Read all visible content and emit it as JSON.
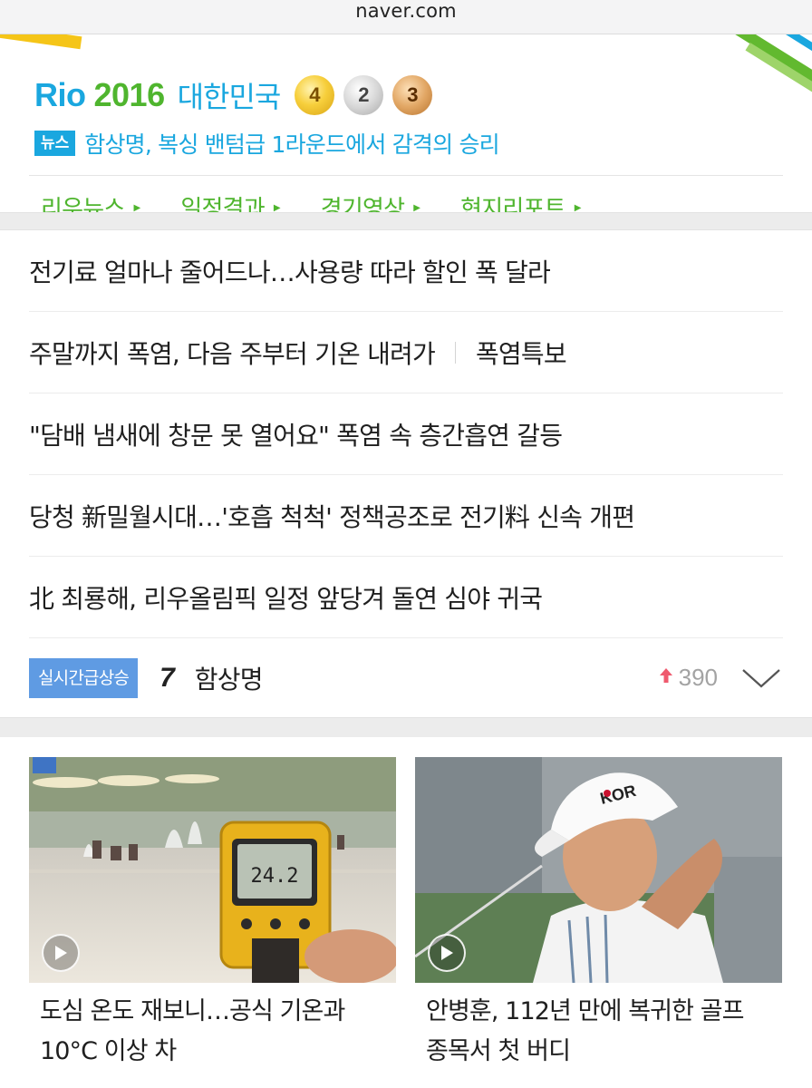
{
  "browser": {
    "url": "naver.com"
  },
  "olympics": {
    "brand_rio": "Rio",
    "brand_year": "2016",
    "country": "대한민국",
    "medals": {
      "gold": "4",
      "silver": "2",
      "bronze": "3"
    },
    "news_badge": "뉴스",
    "news_headline": "함상명, 복싱 밴텀급 1라운드에서 감격의 승리",
    "nav": [
      "리우뉴스",
      "일정결과",
      "경기영상",
      "현지리포트"
    ]
  },
  "headlines": [
    "전기료 얼마나 줄어드나…사용량 따라 할인 폭 달라",
    "주말까지 폭염, 다음 주부터 기온 내려가",
    "\"담배 냄새에 창문 못 열어요\" 폭염 속 층간흡연 갈등",
    "당청 新밀월시대…'호흡 척척' 정책공조로 전기料 신속 개편",
    "北 최룡해, 리우올림픽 일정 앞당겨 돌연 심야 귀국"
  ],
  "headline_tag": "폭염특보",
  "trending": {
    "badge": "실시간급상승",
    "rank": "7",
    "term": "함상명",
    "count": "390"
  },
  "cards": [
    {
      "title_line1": "도심 온도 재보니…공식 기온과",
      "title_line2": "10°C 이상 차",
      "thermo_reading": "24.2"
    },
    {
      "title_line1": "안병훈, 112년 만에 복귀한 골프",
      "title_line2": "종목서 첫 버디",
      "cap_text": "KOR"
    }
  ],
  "colors": {
    "rio_blue": "#1aa7df",
    "rio_green": "#4fb52e",
    "trend_badge": "#5f9be3",
    "trend_up": "#ef5a6e"
  }
}
